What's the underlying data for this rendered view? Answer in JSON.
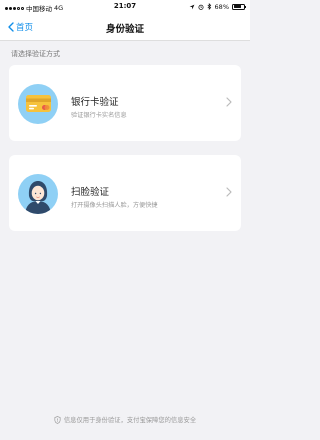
{
  "status_bar": {
    "carrier": "中国移动",
    "network": "4G",
    "time": "21:07",
    "battery_text": "68%",
    "battery_level": 0.68
  },
  "nav": {
    "back_label": "首页",
    "title": "身份验证"
  },
  "section_label": "请选择验证方式",
  "options": [
    {
      "title": "银行卡验证",
      "description": "验证银行卡实名信息",
      "icon": "bank-card-icon"
    },
    {
      "title": "扫脸验证",
      "description": "打开摄像头扫描人脸，方便快捷",
      "icon": "face-scan-icon"
    }
  ],
  "footer": {
    "text": "信息仅用于身份验证，支付宝保障您的信息安全",
    "icon": "shield-icon"
  },
  "colors": {
    "accent": "#108ee9",
    "icon_bg": "#8fd0f5",
    "card_yellow": "#f6c23c",
    "card_red": "#e8584a"
  }
}
